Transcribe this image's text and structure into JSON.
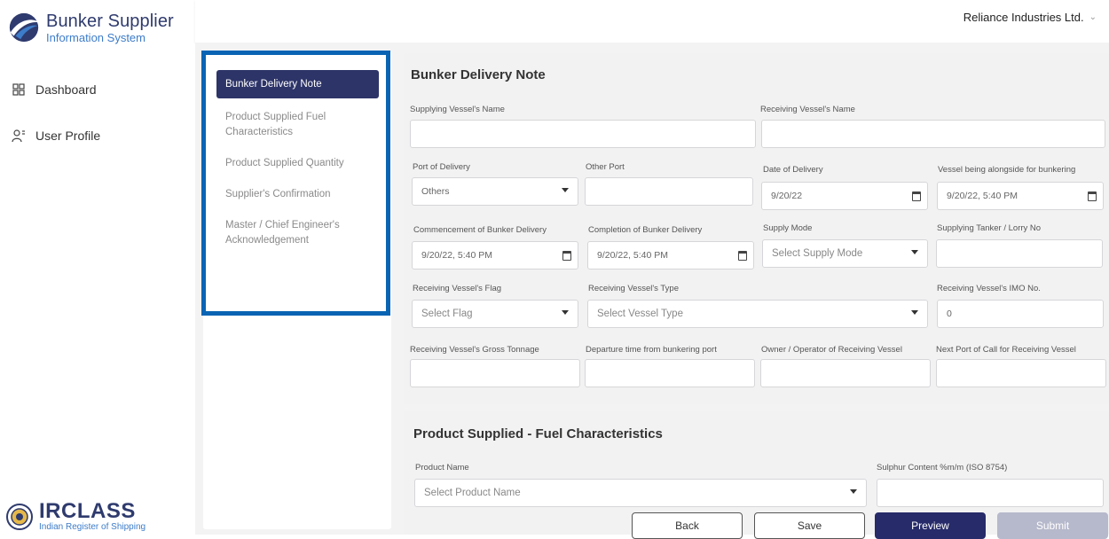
{
  "brand": {
    "title": "Bunker Supplier",
    "subtitle": "Information System"
  },
  "nav": {
    "items": [
      {
        "label": "Dashboard",
        "icon": "dashboard-icon"
      },
      {
        "label": "User Profile",
        "icon": "user-profile-icon"
      }
    ]
  },
  "footer": {
    "logo_text": "IRCLASS",
    "logo_sub": "Indian Register of Shipping"
  },
  "topbar": {
    "company": "Reliance Industries Ltd."
  },
  "sections": [
    {
      "label": "Bunker Delivery Note",
      "active": true
    },
    {
      "label": "Product Supplied Fuel Characteristics",
      "active": false
    },
    {
      "label": "Product Supplied Quantity",
      "active": false
    },
    {
      "label": "Supplier's Confirmation",
      "active": false
    },
    {
      "label": "Master / Chief Engineer's Acknowledgement",
      "active": false
    }
  ],
  "bdn": {
    "title": "Bunker Delivery Note",
    "supplying_vessel_name": {
      "label": "Supplying Vessel's Name",
      "value": ""
    },
    "receiving_vessel_name": {
      "label": "Receiving Vessel's Name",
      "value": ""
    },
    "port_of_delivery": {
      "label": "Port of Delivery",
      "value": "Others"
    },
    "other_port": {
      "label": "Other Port",
      "value": ""
    },
    "date_of_delivery": {
      "label": "Date of Delivery",
      "value": "9/20/22"
    },
    "vessel_alongside": {
      "label": "Vessel being alongside for bunkering",
      "value": "9/20/22, 5:40 PM"
    },
    "commencement": {
      "label": "Commencement of Bunker Delivery",
      "value": "9/20/22, 5:40 PM"
    },
    "completion": {
      "label": "Completion of Bunker Delivery",
      "value": "9/20/22, 5:40 PM"
    },
    "supply_mode": {
      "label": "Supply Mode",
      "value": "Select Supply Mode"
    },
    "tanker_no": {
      "label": "Supplying Tanker / Lorry No",
      "value": ""
    },
    "flag": {
      "label": "Receiving Vessel's Flag",
      "value": "Select Flag"
    },
    "vessel_type": {
      "label": "Receiving Vessel's Type",
      "value": "Select Vessel Type"
    },
    "imo_no": {
      "label": "Receiving Vessel's IMO No.",
      "value": "0"
    },
    "gross_tonnage": {
      "label": "Receiving Vessel's Gross Tonnage",
      "value": ""
    },
    "departure_time": {
      "label": "Departure time from bunkering port",
      "value": ""
    },
    "owner_operator": {
      "label": "Owner / Operator of Receiving Vessel",
      "value": ""
    },
    "next_port": {
      "label": "Next Port of Call for Receiving Vessel",
      "value": ""
    }
  },
  "fuel": {
    "title": "Product Supplied - Fuel Characteristics",
    "product_name": {
      "label": "Product Name",
      "value": "Select Product Name"
    },
    "sulphur": {
      "label": "Sulphur Content %m/m (ISO 8754)",
      "value": ""
    }
  },
  "buttons": {
    "back": "Back",
    "save": "Save",
    "preview": "Preview",
    "submit": "Submit"
  },
  "colors": {
    "primary": "#272b69",
    "highlight": "#0a64b4",
    "disabled": "#b6b8cb"
  }
}
